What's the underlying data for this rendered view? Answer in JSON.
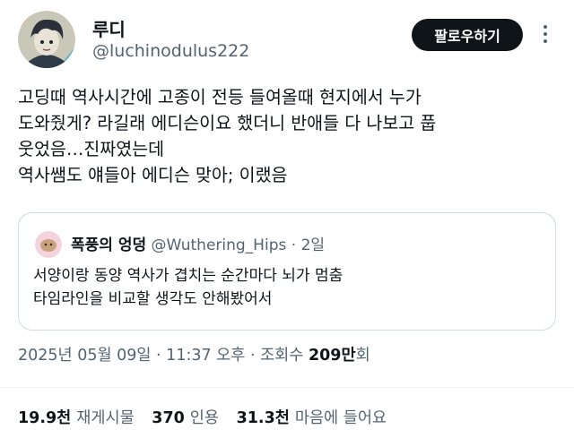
{
  "author": {
    "display_name": "루디",
    "handle": "@luchinodulus222"
  },
  "follow_label": "팔로우하기",
  "tweet": {
    "lines": [
      "고딩때 역사시간에 고종이 전등 들여올때 현지에서 누가",
      "도와줬게? 라길래 에디슨이요 했더니 반애들 다 나보고 풉",
      "웃었음…진짜였는데",
      "역사쌤도 얘들아 에디슨 맞아; 이랬음"
    ]
  },
  "quote": {
    "display_name": "폭풍의 엉덩",
    "handle": "@Wuthering_Hips",
    "separator": " · ",
    "time": "2일",
    "lines": [
      "서양이랑 동양 역사가 겹치는 순간마다 뇌가 멈춤",
      "타임라인을 비교할 생각도 안해봤어서"
    ]
  },
  "meta": {
    "date_time": "2025년 05월 09일 · 11:37 오후 · 조회수 ",
    "views_number": "209만",
    "views_suffix": "회"
  },
  "stats": {
    "reposts_count": "19.9천",
    "reposts_label": "재게시물",
    "quotes_count": "370",
    "quotes_label": "인용",
    "likes_count": "31.3천",
    "likes_label": "마음에 들어요"
  }
}
